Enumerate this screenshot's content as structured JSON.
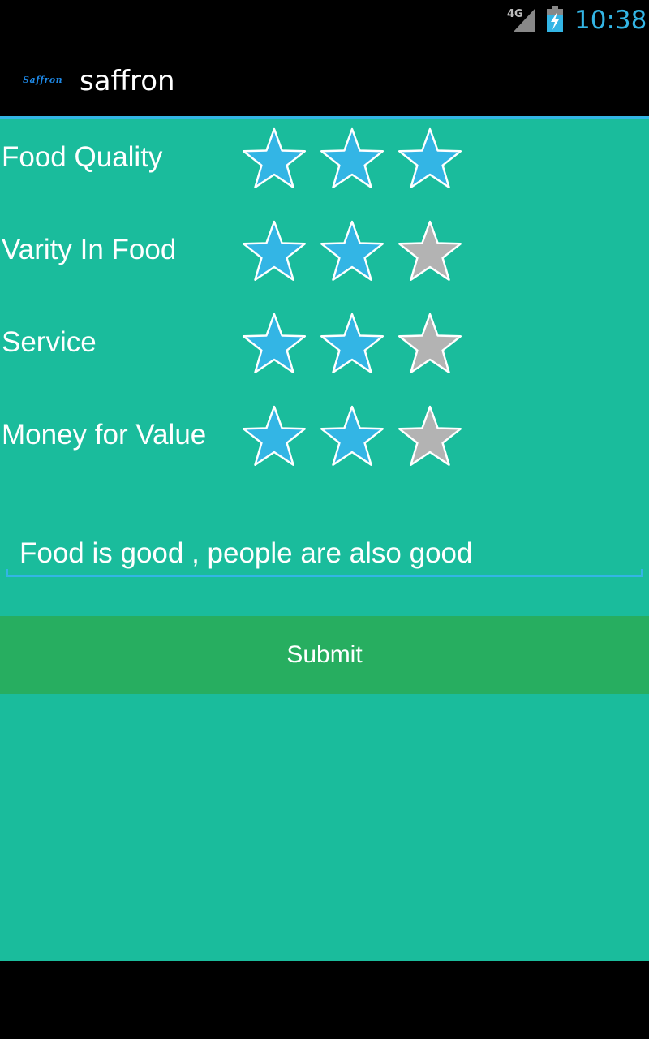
{
  "status_bar": {
    "network_label": "4G",
    "time": "10:38",
    "accent_color": "#33b5e5"
  },
  "action_bar": {
    "logo_text": "Saffron",
    "title": "saffron"
  },
  "ratings": [
    {
      "label": "Food Quality",
      "rating": 3,
      "max": 3
    },
    {
      "label": "Varity In Food",
      "rating": 2,
      "max": 3
    },
    {
      "label": "Service",
      "rating": 2,
      "max": 3
    },
    {
      "label": "Money for Value",
      "rating": 2,
      "max": 3
    }
  ],
  "comment": {
    "value": "Food is good , people are also good"
  },
  "submit": {
    "label": "Submit"
  },
  "colors": {
    "background": "#1abc9c",
    "button": "#27ae60",
    "star_filled": "#33b5e5",
    "star_empty": "#b3b3b3",
    "star_outline": "#ffffff"
  }
}
